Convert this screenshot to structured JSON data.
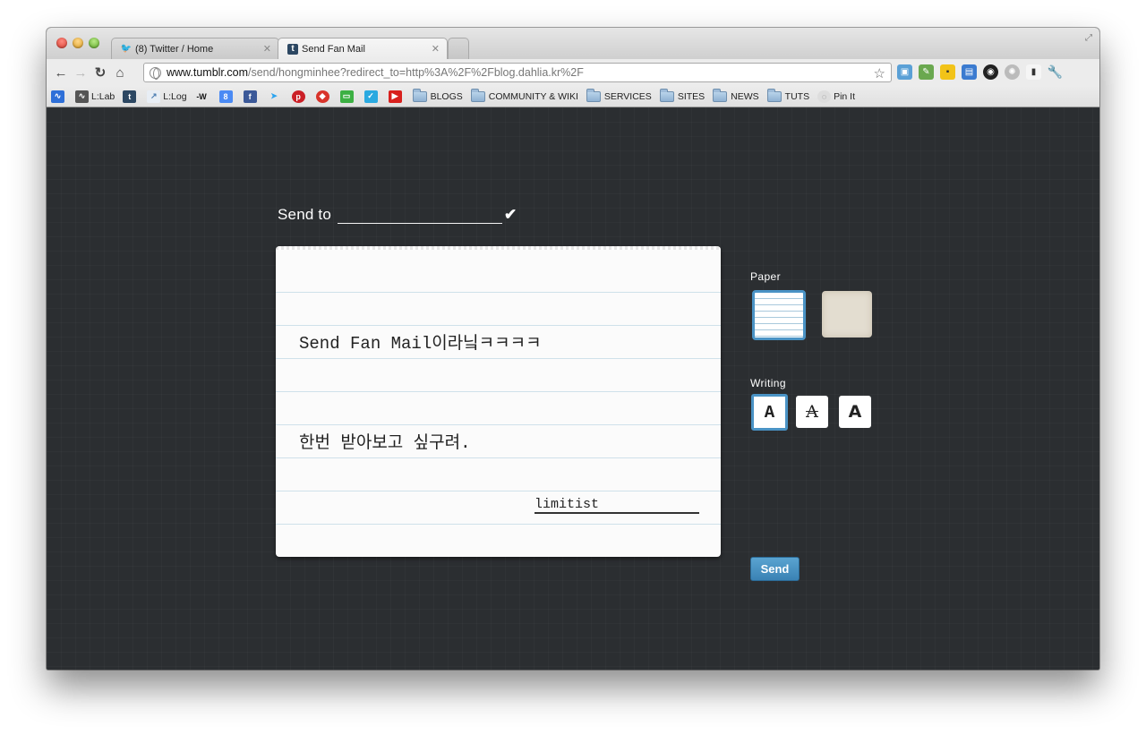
{
  "browser": {
    "tabs": [
      {
        "label": "(8) Twitter / Home",
        "icon": "twitter-icon"
      },
      {
        "label": "Send Fan Mail",
        "icon": "tumblr-icon"
      }
    ],
    "url_domain": "www.tumblr.com",
    "url_path": "/send/hongminhee?redirect_to=http%3A%2F%2Fblog.dahlia.kr%2F",
    "bookmarks": [
      {
        "label": "",
        "icon": "activity-icon",
        "type": "link"
      },
      {
        "label": "L:Lab",
        "icon": "lab-icon",
        "type": "link"
      },
      {
        "label": "",
        "icon": "tumblr-icon",
        "type": "link"
      },
      {
        "label": "L:Log",
        "icon": "log-icon",
        "type": "link"
      },
      {
        "label": "",
        "icon": "w-icon",
        "type": "link"
      },
      {
        "label": "",
        "icon": "google-plus-icon",
        "type": "link"
      },
      {
        "label": "",
        "icon": "facebook-icon",
        "type": "link"
      },
      {
        "label": "",
        "icon": "twitter-icon",
        "type": "link"
      },
      {
        "label": "",
        "icon": "pinterest-icon",
        "type": "link"
      },
      {
        "label": "",
        "icon": "gem-icon",
        "type": "link"
      },
      {
        "label": "",
        "icon": "battery-icon",
        "type": "link"
      },
      {
        "label": "",
        "icon": "foursquare-icon",
        "type": "link"
      },
      {
        "label": "",
        "icon": "youtube-icon",
        "type": "link"
      },
      {
        "label": "BLOGS",
        "icon": "folder-icon",
        "type": "folder"
      },
      {
        "label": "COMMUNITY & WIKI",
        "icon": "folder-icon",
        "type": "folder"
      },
      {
        "label": "SERVICES",
        "icon": "folder-icon",
        "type": "folder"
      },
      {
        "label": "SITES",
        "icon": "folder-icon",
        "type": "folder"
      },
      {
        "label": "NEWS",
        "icon": "folder-icon",
        "type": "folder"
      },
      {
        "label": "TUTS",
        "icon": "folder-icon",
        "type": "folder"
      },
      {
        "label": "Pin It",
        "icon": "pin-icon",
        "type": "link"
      }
    ]
  },
  "form": {
    "send_to_label": "Send to",
    "recipient_value": "",
    "message_line1": "Send Fan Mail이라닠ㅋㅋㅋㅋ",
    "message_line2": "한번 받아보고 싶구려.",
    "signature": "limitist",
    "paper_label": "Paper",
    "writing_label": "Writing",
    "font_glyph": "A",
    "send_button": "Send"
  },
  "colors": {
    "page_bg": "#2b2e31",
    "accent": "#4a93c5",
    "send_button": "#3a82b4"
  }
}
